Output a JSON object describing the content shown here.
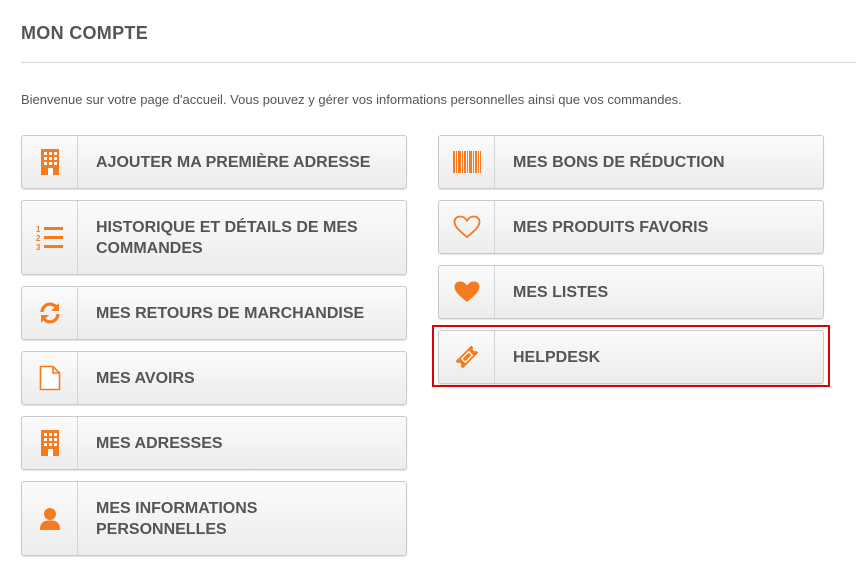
{
  "page": {
    "title": "MON COMPTE",
    "intro": "Bienvenue sur votre page d'accueil. Vous pouvez y gérer vos informations personnelles ainsi que vos commandes."
  },
  "colors": {
    "accent": "#f47b20",
    "highlight": "#e00000"
  },
  "left_buttons": [
    {
      "label": "AJOUTER MA PREMIÈRE ADRESSE",
      "icon": "building-icon"
    },
    {
      "label": "HISTORIQUE ET DÉTAILS DE MES COMMANDES",
      "icon": "ordered-list-icon"
    },
    {
      "label": "MES RETOURS DE MARCHANDISE",
      "icon": "refresh-icon"
    },
    {
      "label": "MES AVOIRS",
      "icon": "document-icon"
    },
    {
      "label": "MES ADRESSES",
      "icon": "building-icon"
    },
    {
      "label": "MES INFORMATIONS PERSONNELLES",
      "icon": "user-icon"
    }
  ],
  "right_buttons": [
    {
      "label": "MES BONS DE RÉDUCTION",
      "icon": "barcode-icon"
    },
    {
      "label": "MES PRODUITS FAVORIS",
      "icon": "heart-outline-icon"
    },
    {
      "label": "MES LISTES",
      "icon": "heart-filled-icon"
    },
    {
      "label": "HELPDESK",
      "icon": "ticket-icon",
      "highlighted": true
    }
  ]
}
